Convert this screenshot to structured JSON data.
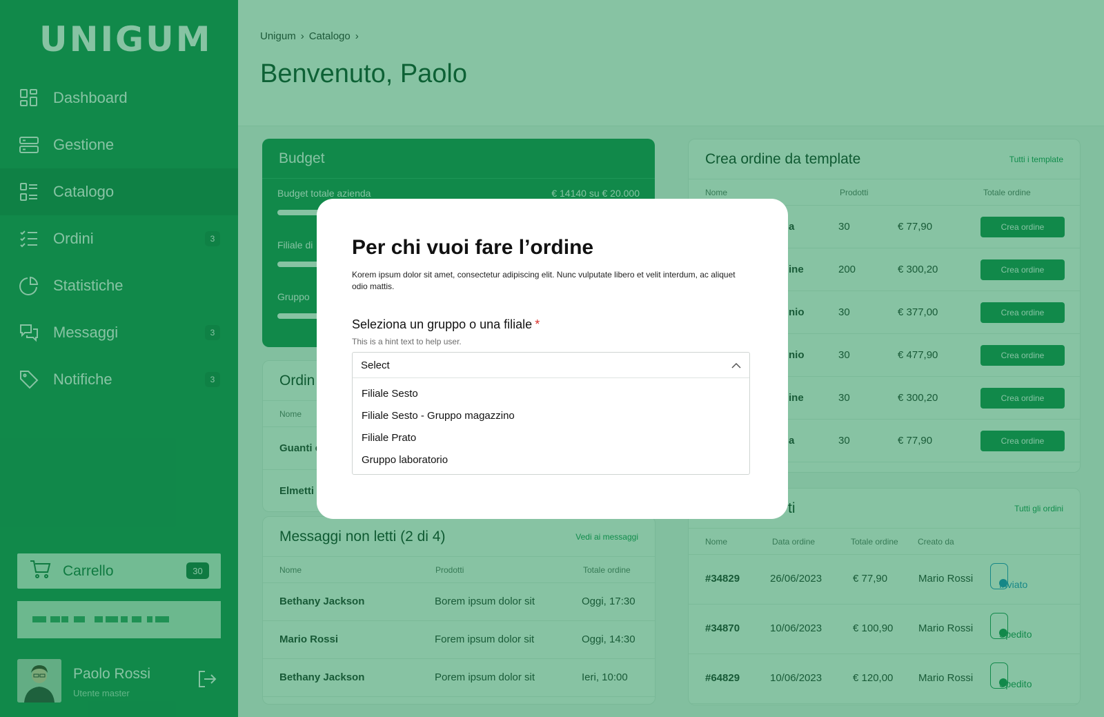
{
  "app": {
    "logo": "UNIGUM"
  },
  "sidebar": {
    "items": [
      {
        "label": "Dashboard",
        "icon": "dashboard-icon",
        "badge": ""
      },
      {
        "label": "Gestione",
        "icon": "server-icon",
        "badge": ""
      },
      {
        "label": "Catalogo",
        "icon": "list-icon",
        "badge": ""
      },
      {
        "label": "Ordini",
        "icon": "checklist-icon",
        "badge": "3"
      },
      {
        "label": "Statistiche",
        "icon": "pie-chart-icon",
        "badge": ""
      },
      {
        "label": "Messaggi",
        "icon": "chat-icon",
        "badge": "3"
      },
      {
        "label": "Notifiche",
        "icon": "tag-icon",
        "badge": "3"
      }
    ],
    "cart": {
      "label": "Carrello",
      "count": "30"
    },
    "user": {
      "name": "Paolo Rossi",
      "role": "Utente master"
    }
  },
  "header": {
    "breadcrumb": [
      "Unigum",
      "Catalogo"
    ],
    "title": "Benvenuto, Paolo"
  },
  "budget": {
    "title": "Budget",
    "total_label": "Budget totale azienda",
    "total_value": "€ 14140 su  € 20.000",
    "total_progress": 0.707,
    "filiale_label": "Filiale di",
    "gruppo_label": "Gruppo",
    "filiale_progress": 0.2,
    "gruppo_progress": 0.2
  },
  "ordini_card": {
    "title": "Ordin",
    "col_nome": "Nome",
    "rows": [
      "Guanti c",
      "Elmetti c"
    ]
  },
  "messages": {
    "title": "Messaggi non letti (2 di 4)",
    "link": "Vedi ai messaggi",
    "columns": [
      "Nome",
      "Prodotti",
      "Totale ordine"
    ],
    "rows": [
      {
        "name": "Bethany Jackson",
        "text": "Borem ipsum dolor sit",
        "time": "Oggi, 17:30"
      },
      {
        "name": "Mario Rossi",
        "text": "Forem ipsum dolor sit",
        "time": "Oggi, 14:30"
      },
      {
        "name": "Bethany Jackson",
        "text": "Porem ipsum dolor sit",
        "time": "Ieri, 10:00"
      }
    ]
  },
  "templates": {
    "title": "Crea ordine da template",
    "link": "Tutti i template",
    "columns": [
      "Nome",
      "Prodotti",
      "Totale ordine"
    ],
    "button": "Crea ordine",
    "rows": [
      {
        "name": "a",
        "qty": "30",
        "total": "€ 77,90"
      },
      {
        "name": "ine",
        "qty": "200",
        "total": "€ 300,20"
      },
      {
        "name": "nio",
        "qty": "30",
        "total": "€ 377,00"
      },
      {
        "name": "nio",
        "qty": "30",
        "total": "€ 477,90"
      },
      {
        "name": "ine",
        "qty": "30",
        "total": "€ 300,20"
      },
      {
        "name": "a",
        "qty": "30",
        "total": "€ 77,90"
      }
    ]
  },
  "orders": {
    "title": "ti",
    "link": "Tutti gli ordini",
    "columns": [
      "Nome",
      "Data ordine",
      "Totale ordine",
      "Creato da"
    ],
    "rows": [
      {
        "id": "#34829",
        "date": "26/06/2023",
        "total": "€ 77,90",
        "by": "Mario Rossi",
        "status": "Inviato"
      },
      {
        "id": "#34870",
        "date": "10/06/2023",
        "total": "€ 100,90",
        "by": "Mario Rossi",
        "status": "Spedito"
      },
      {
        "id": "#64829",
        "date": "10/06/2023",
        "total": "€ 120,00",
        "by": "Mario Rossi",
        "status": "Spedito"
      }
    ]
  },
  "modal": {
    "title": "Per chi vuoi fare l’ordine",
    "description": "Korem ipsum dolor sit amet, consectetur adipiscing elit. Nunc vulputate libero et velit interdum, ac aliquet odio mattis.",
    "field_label": "Seleziona un gruppo o una filiale",
    "required_mark": "*",
    "hint": "This is a hint text to help user.",
    "select_value": "Select",
    "options": [
      "Filiale Sesto",
      "Filiale Sesto - Gruppo magazzino",
      "Filiale Prato",
      "Gruppo laboratorio"
    ]
  },
  "colors": {
    "brand": "#138a4d",
    "overlay": "#108748",
    "info": "#1b87c6",
    "required": "#d9302b"
  }
}
